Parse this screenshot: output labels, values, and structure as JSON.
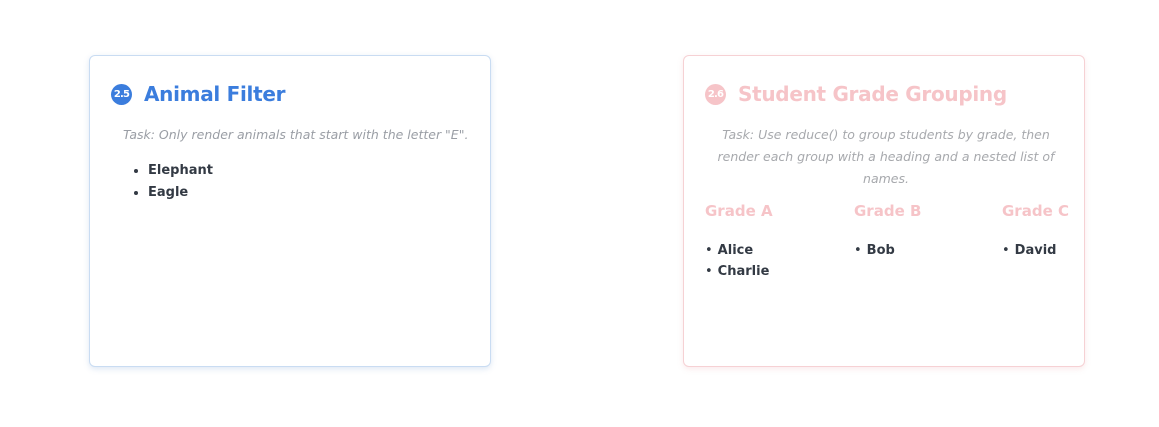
{
  "cards": {
    "animal_filter": {
      "number": "2.5",
      "title": "Animal Filter",
      "task": "Task: Only render animals that start with the letter \"E\".",
      "animals": [
        "Elephant",
        "Eagle"
      ],
      "accent_color": "#3b7ddd"
    },
    "student_grades": {
      "number": "2.6",
      "title": "Student Grade Grouping",
      "task": "Task: Use reduce() to group students by grade, then render each group with a heading and a nested list of names.",
      "accent_color": "#f6c4c8",
      "groups": [
        {
          "heading": "Grade A",
          "names": [
            "Alice",
            "Charlie"
          ]
        },
        {
          "heading": "Grade B",
          "names": [
            "Bob"
          ]
        },
        {
          "heading": "Grade C",
          "names": [
            "David"
          ]
        }
      ]
    }
  }
}
